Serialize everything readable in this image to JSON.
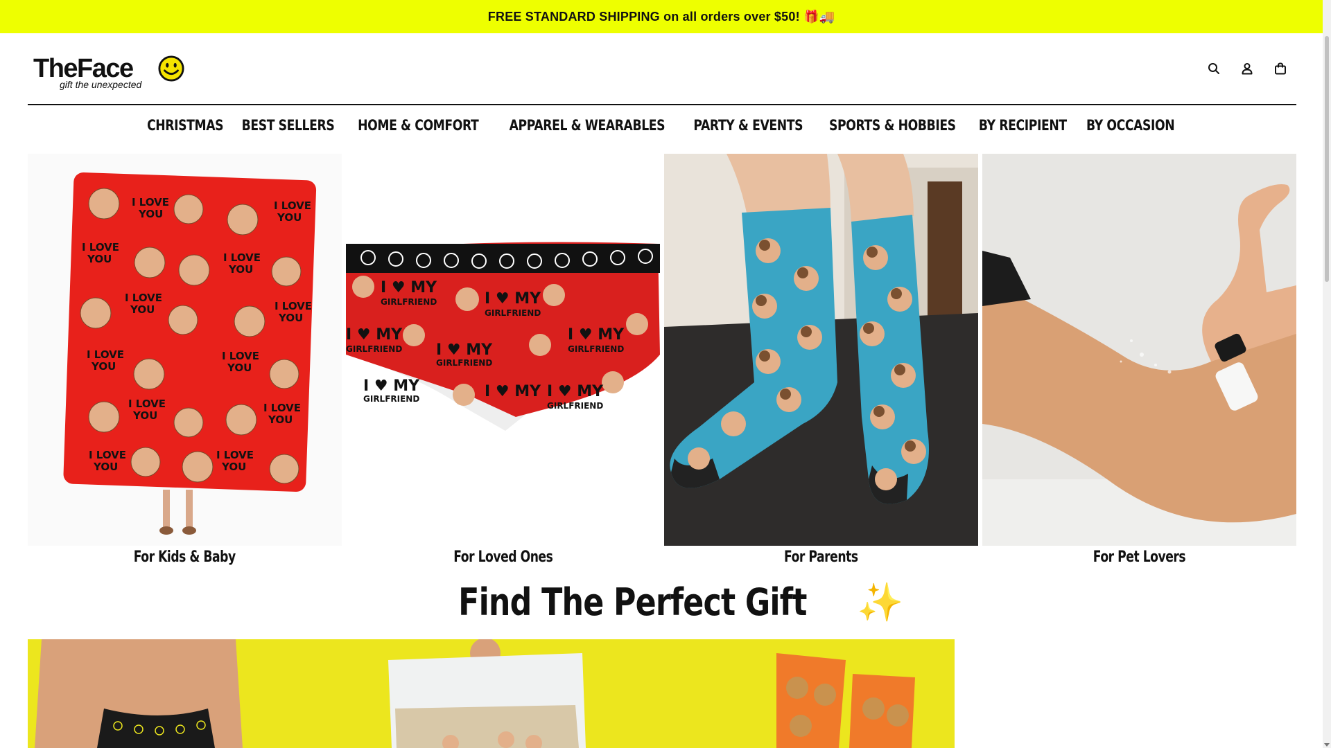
{
  "announcement": {
    "text": "FREE STANDARD SHIPPING on all orders over $50! 🎁🚚"
  },
  "logo": {
    "wordmark": "TheFace",
    "tagline": "gift the unexpected",
    "accent_color": "#f5e400"
  },
  "header": {
    "icons": [
      "search-icon",
      "account-icon",
      "cart-icon"
    ]
  },
  "nav": {
    "items": [
      "CHRISTMAS",
      "BEST SELLERS",
      "HOME & COMFORT",
      "APPAREL & WEARABLES",
      "PARTY & EVENTS",
      "SPORTS & HOBBIES",
      "BY RECIPIENT",
      "BY OCCASION"
    ]
  },
  "categories": [
    {
      "label": "For Kids & Baby",
      "image": "face-blanket"
    },
    {
      "label": "For Loved Ones",
      "image": "face-boxer-briefs"
    },
    {
      "label": "For Parents",
      "image": "face-socks"
    },
    {
      "label": "For Pet Lovers",
      "image": "hand-applying-cream"
    }
  ],
  "section": {
    "title": "Find The Perfect Gift",
    "emoji": "✨"
  },
  "colors": {
    "announcement_bg": "#eeff00",
    "banner_bg": "#ece61e",
    "blanket_red": "#e8211b",
    "sock_blue": "#3aa5c4",
    "dog_sock_orange": "#f07a2a"
  }
}
